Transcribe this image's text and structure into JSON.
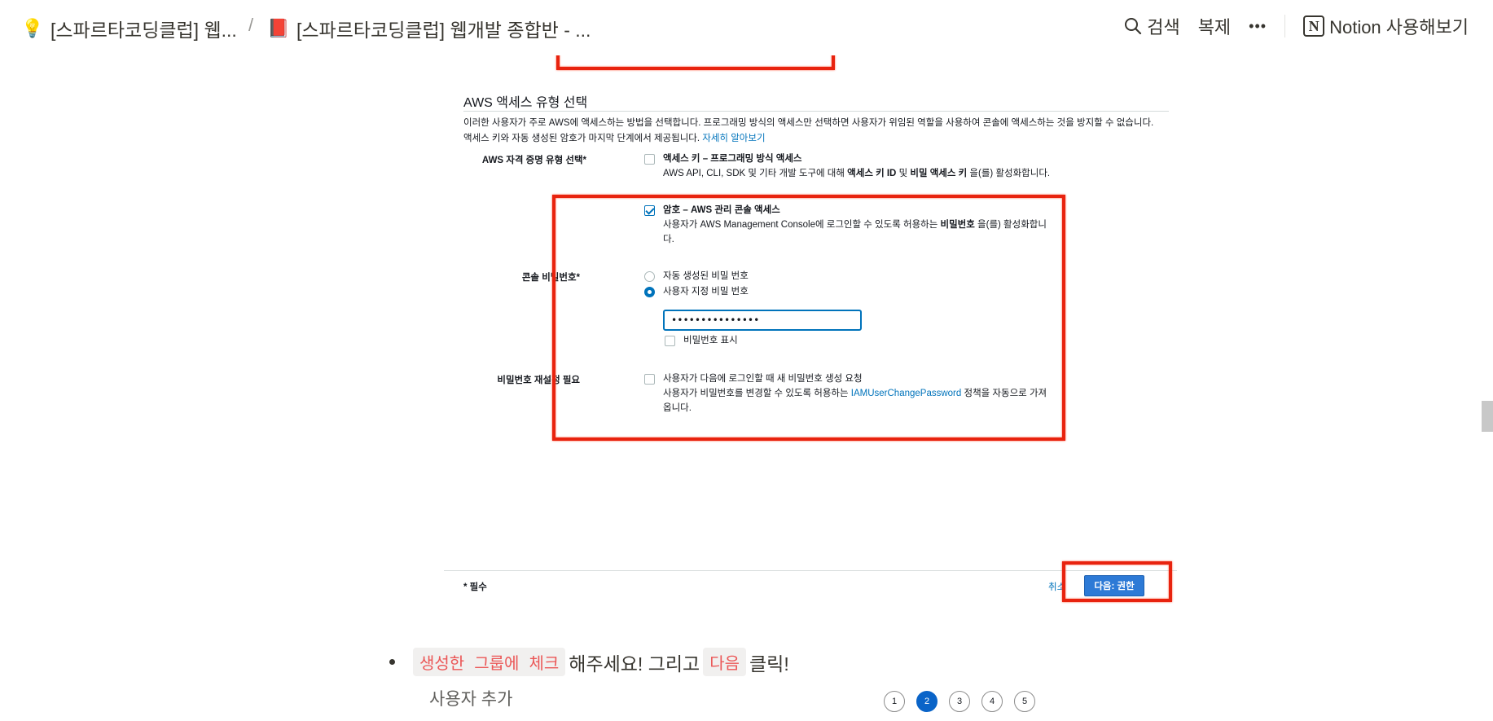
{
  "topbar": {
    "crumbs": [
      {
        "icon": "lightbulb-icon",
        "glyph": "💡",
        "label": "[스파르타코딩클럽] 웹..."
      },
      {
        "icon": "red-book-icon",
        "glyph": "📕",
        "label": "[스파르타코딩클럽] 웹개발 종합반 - ..."
      }
    ],
    "separator": "/",
    "search_label": "검색",
    "duplicate_label": "복제",
    "more_label": "•••",
    "notion_logo": "N",
    "try_notion_label": "Notion 사용해보기"
  },
  "aws": {
    "section_title": "AWS 액세스 유형 선택",
    "description": "이러한 사용자가 주로 AWS에 액세스하는 방법을 선택합니다. 프로그래밍 방식의 액세스만 선택하면 사용자가 위임된 역할을 사용하여 콘솔에 액세스하는 것을 방지할 수 없습니다. 액세스 키와 자동 생성된 암호가 마지막 단계에서 제공됩니다.",
    "learn_more": "자세히 알아보기",
    "cred_type_label": "AWS 자격 증명 유형 선택*",
    "access_key_title": "액세스 키 – 프로그래밍 방식 액세스",
    "access_key_desc_1": "AWS API, CLI, SDK 및 기타 개발 도구에 대해 ",
    "access_key_desc_b1": "액세스 키 ID",
    "access_key_desc_2": " 및 ",
    "access_key_desc_b2": "비밀 액세스 키",
    "access_key_desc_3": " 을(를) 활성화합니다.",
    "password_title": "암호 – AWS 관리 콘솔 액세스",
    "password_desc_1": "사용자가 AWS Management Console에 로그인할 수 있도록 허용하는 ",
    "password_desc_b": "비밀번호",
    "password_desc_2": " 을(를) 활성화합니다.",
    "console_pw_label": "콘솔 비밀번호*",
    "auto_pw": "자동 생성된 비밀 번호",
    "custom_pw": "사용자 지정 비밀 번호",
    "pw_value": "•••••••••••••••",
    "show_pw": "비밀번호 표시",
    "reset_label": "비밀번호 재설정 필요",
    "reset_desc_1": "사용자가 다음에 로그인할 때 새 비밀번호 생성 요청",
    "reset_desc_2": "사용자가 비밀번호를 변경할 수 있도록 허용하는 ",
    "reset_link": "IAMUserChangePassword",
    "reset_desc_3": " 정책을 자동으로 가져옵니다.",
    "required_note": "* 필수",
    "cancel": "취소",
    "next_button": "다음: 권한"
  },
  "bullet": {
    "code1": "생성한 그룹에 체크",
    "text1": "해주세요! 그리고 ",
    "code2": "다음",
    "text2": " 클릭!"
  },
  "next_shot": {
    "title": "사용자 추가",
    "steps": [
      "1",
      "2",
      "3",
      "4",
      "5"
    ],
    "active_step": "2"
  },
  "colors": {
    "highlight_red": "#e8230f",
    "aws_blue": "#0073bb",
    "inline_code_red": "#eb5757"
  }
}
